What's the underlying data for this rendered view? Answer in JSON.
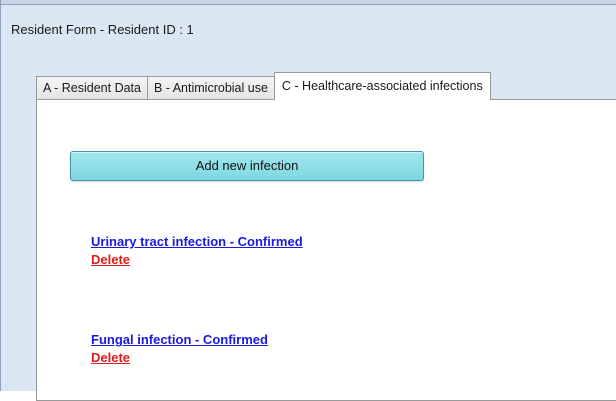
{
  "window": {
    "title": "Resident Form - Resident ID : 1"
  },
  "tabs": [
    {
      "label": "A - Resident Data",
      "active": false
    },
    {
      "label": "B - Antimicrobial use",
      "active": false
    },
    {
      "label": "C - Healthcare-associated infections",
      "active": true
    }
  ],
  "panel": {
    "add_button_label": "Add new infection",
    "infections": [
      {
        "label": "Urinary tract infection - Confirmed",
        "delete_label": "Delete"
      },
      {
        "label": "Fungal infection - Confirmed",
        "delete_label": "Delete"
      }
    ]
  },
  "colors": {
    "link": "#1a1adb",
    "delete": "#e01b1b",
    "button": "#8fdfe7",
    "window_bg": "#dbe6f3"
  }
}
